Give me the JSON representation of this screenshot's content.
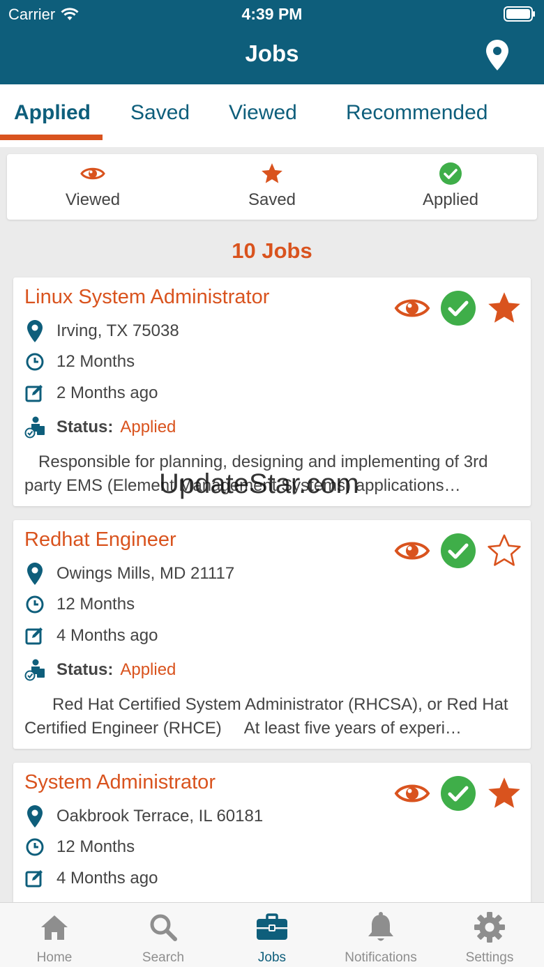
{
  "status_bar": {
    "carrier": "Carrier",
    "time": "4:39 PM"
  },
  "header": {
    "title": "Jobs"
  },
  "tabs": [
    {
      "label": "Applied",
      "active": true
    },
    {
      "label": "Saved",
      "active": false
    },
    {
      "label": "Viewed",
      "active": false
    },
    {
      "label": "Recommended",
      "active": false
    }
  ],
  "filters": [
    {
      "label": "Viewed",
      "icon": "eye-icon"
    },
    {
      "label": "Saved",
      "icon": "star-icon"
    },
    {
      "label": "Applied",
      "icon": "check-circle-icon"
    }
  ],
  "jobs_count": "10 Jobs",
  "status_label": "Status:",
  "jobs": [
    {
      "title": "Linux System Administrator",
      "location": "Irving, TX 75038",
      "duration": "12 Months",
      "posted": "2 Months ago",
      "status": "Applied",
      "description": "   Responsible for planning, designing and implementing of 3rd party EMS (Element Management Systems) applications…",
      "saved": true
    },
    {
      "title": "Redhat Engineer",
      "location": "Owings Mills, MD 21117",
      "duration": "12 Months",
      "posted": "4 Months ago",
      "status": "Applied",
      "description": "      Red Hat Certified System Administrator (RHCSA), or Red Hat Certified Engineer (RHCE)     At least five years of experi…",
      "saved": false
    },
    {
      "title": "System Administrator",
      "location": "Oakbrook Terrace, IL 60181",
      "duration": "12 Months",
      "posted": "4 Months ago",
      "status": "Applied",
      "saved": true
    }
  ],
  "watermark": "UpdateStar.com",
  "bottom_tabs": [
    {
      "label": "Home",
      "icon": "home-icon",
      "active": false
    },
    {
      "label": "Search",
      "icon": "search-icon",
      "active": false
    },
    {
      "label": "Jobs",
      "icon": "briefcase-icon",
      "active": true
    },
    {
      "label": "Notifications",
      "icon": "bell-icon",
      "active": false
    },
    {
      "label": "Settings",
      "icon": "gear-icon",
      "active": false
    }
  ],
  "colors": {
    "primary": "#0e5e7b",
    "accent": "#d9531e",
    "success": "#3fae49",
    "inactive": "#8e8e8e"
  }
}
